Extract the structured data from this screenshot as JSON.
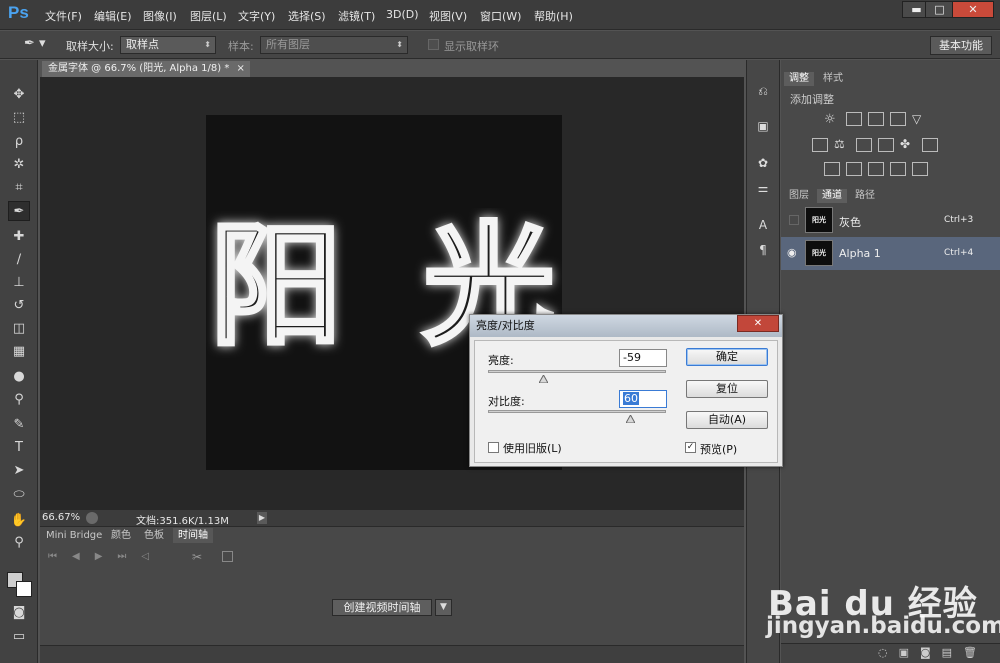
{
  "app": {
    "logo": "Ps"
  },
  "menu": [
    "文件(F)",
    "编辑(E)",
    "图像(I)",
    "图层(L)",
    "文字(Y)",
    "选择(S)",
    "滤镜(T)",
    "3D(D)",
    "视图(V)",
    "窗口(W)",
    "帮助(H)"
  ],
  "window_controls": {
    "minimize": "▬",
    "maximize": "□",
    "close": "✕"
  },
  "options": {
    "sample_size_label": "取样大小:",
    "sample_size_value": "取样点",
    "sample_label": "样本:",
    "sample_value": "所有图层",
    "show_ring_label": "显示取样环",
    "workspace": "基本功能"
  },
  "document": {
    "tab_title": "金属字体 @ 66.7% (阳光, Alpha 1/8) *",
    "tab_close": "×",
    "canvas_text": "阳光",
    "zoom": "66.67%",
    "doc_info": "文档:351.6K/1.13M"
  },
  "bottom_panel": {
    "tabs": [
      "Mini Bridge",
      "颜色",
      "色板",
      "时间轴"
    ],
    "active_tab": "时间轴",
    "create_button": "创建视频时间轴"
  },
  "right_panel": {
    "top_tabs": [
      "调整",
      "样式"
    ],
    "adjust_title": "添加调整",
    "bottom_tabs": [
      "图层",
      "通道",
      "路径"
    ],
    "channels": [
      {
        "thumb": "阳光",
        "name": "灰色",
        "shortcut": "Ctrl+3",
        "selected": false
      },
      {
        "thumb": "阳光",
        "name": "Alpha 1",
        "shortcut": "Ctrl+4",
        "selected": true
      }
    ]
  },
  "dialog": {
    "title": "亮度/对比度",
    "close": "✕",
    "brightness_label": "亮度:",
    "brightness_value": "-59",
    "contrast_label": "对比度:",
    "contrast_value": "60",
    "legacy_label": "使用旧版(L)",
    "legacy_checked": false,
    "preview_label": "预览(P)",
    "preview_checked": true,
    "ok": "确定",
    "reset": "复位",
    "auto": "自动(A)"
  },
  "watermark": {
    "brand": "Bai du 经验",
    "site": "jingyan.baidu.com"
  },
  "colors": {
    "accent": "#4ba3f0",
    "selection": "#59667c",
    "close_red": "#c94a3a"
  }
}
